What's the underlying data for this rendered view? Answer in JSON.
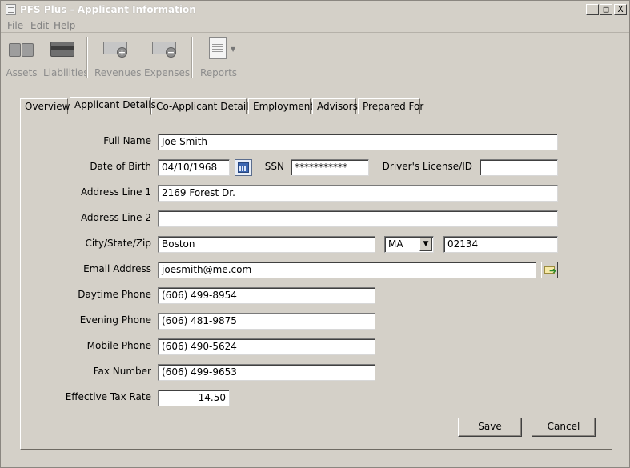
{
  "window": {
    "title": "PFS Plus - Applicant Information"
  },
  "title_buttons": {
    "minimize": "_",
    "maximize": "□",
    "close": "X"
  },
  "menu": [
    "File",
    "Edit",
    "Help"
  ],
  "toolbar": {
    "assets": "Assets",
    "liabilities": "Liabilities",
    "revenues": "Revenues",
    "expenses": "Expenses",
    "reports": "Reports"
  },
  "tabs": [
    "Overview",
    "Applicant Details",
    "Co-Applicant Details",
    "Employment",
    "Advisors",
    "Prepared For"
  ],
  "active_tab": "Applicant Details",
  "form": {
    "full_name": {
      "label": "Full Name",
      "value": "Joe Smith"
    },
    "dob": {
      "label": "Date of Birth",
      "value": "04/10/1968"
    },
    "ssn": {
      "label": "SSN",
      "value": "***********"
    },
    "license": {
      "label": "Driver's License/ID",
      "value": ""
    },
    "address1": {
      "label": "Address Line 1",
      "value": "2169 Forest Dr."
    },
    "address2": {
      "label": "Address Line 2",
      "value": ""
    },
    "city_state_zip": {
      "label": "City/State/Zip",
      "city": "Boston",
      "state": "MA",
      "zip": "02134"
    },
    "email": {
      "label": "Email Address",
      "value": "joesmith@me.com"
    },
    "daytime_phone": {
      "label": "Daytime Phone",
      "value": "(606) 499-8954"
    },
    "evening_phone": {
      "label": "Evening Phone",
      "value": "(606) 481-9875"
    },
    "mobile_phone": {
      "label": "Mobile Phone",
      "value": "(606) 490-5624"
    },
    "fax": {
      "label": "Fax Number",
      "value": "(606) 499-9653"
    },
    "tax_rate": {
      "label": "Effective Tax Rate",
      "value": "14.50"
    }
  },
  "buttons": {
    "save": "Save",
    "cancel": "Cancel"
  }
}
